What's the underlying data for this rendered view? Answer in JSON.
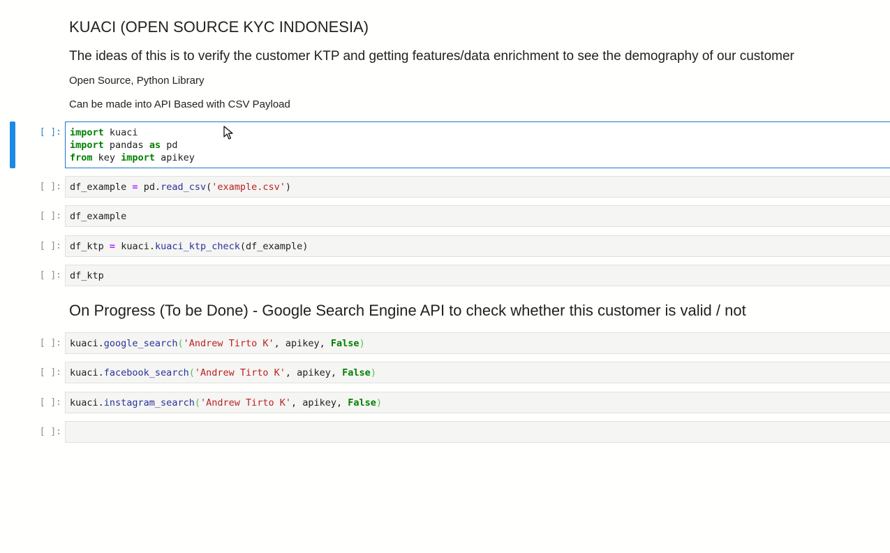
{
  "markdown": {
    "title": "KUACI (OPEN SOURCE KYC INDONESIA)",
    "description": "The ideas of this is to verify the customer KTP and getting features/data enrichment to see the demography of our customer",
    "note1": "Open Source, Python Library",
    "note2": "Can be made into API Based with CSV Payload",
    "section2": "On Progress (To be Done) - Google Search Engine API to check whether this customer is valid / not"
  },
  "prompt_label": "[ ]:",
  "cells": {
    "c1": {
      "l1": {
        "kw": "import",
        "rest": " kuaci"
      },
      "l2": {
        "kw1": "import",
        "mid": " pandas ",
        "kw2": "as",
        "rest": " pd"
      },
      "l3": {
        "kw1": "from",
        "mid": " key ",
        "kw2": "import",
        "rest": " apikey"
      }
    },
    "c2": {
      "var": "df_example",
      "op": "=",
      "obj": " pd.",
      "fn": "read_csv",
      "open": "(",
      "arg": "'example.csv'",
      "close": ")"
    },
    "c3": {
      "text": "df_example"
    },
    "c4": {
      "var": "df_ktp",
      "op": "=",
      "obj": " kuaci.",
      "fn": "kuaci_ktp_check",
      "args": "(df_example)"
    },
    "c5": {
      "text": "df_ktp"
    },
    "c6": {
      "obj": "kuaci.",
      "fn": "google_search",
      "open": "(",
      "arg": "'Andrew Tirto K'",
      "mid": ", apikey, ",
      "kw": "False",
      "close": ")"
    },
    "c7": {
      "obj": "kuaci.",
      "fn": "facebook_search",
      "open": "(",
      "arg": "'Andrew Tirto K'",
      "mid": ", apikey, ",
      "kw": "False",
      "close": ")"
    },
    "c8": {
      "obj": "kuaci.",
      "fn": "instagram_search",
      "open": "(",
      "arg": "'Andrew Tirto K'",
      "mid": ", apikey, ",
      "kw": "False",
      "close": ")"
    }
  },
  "colors": {
    "accent": "#1976d2",
    "keyword": "#008000",
    "string": "#ba2121",
    "function": "#2a3399",
    "operator": "#aa22ff"
  }
}
